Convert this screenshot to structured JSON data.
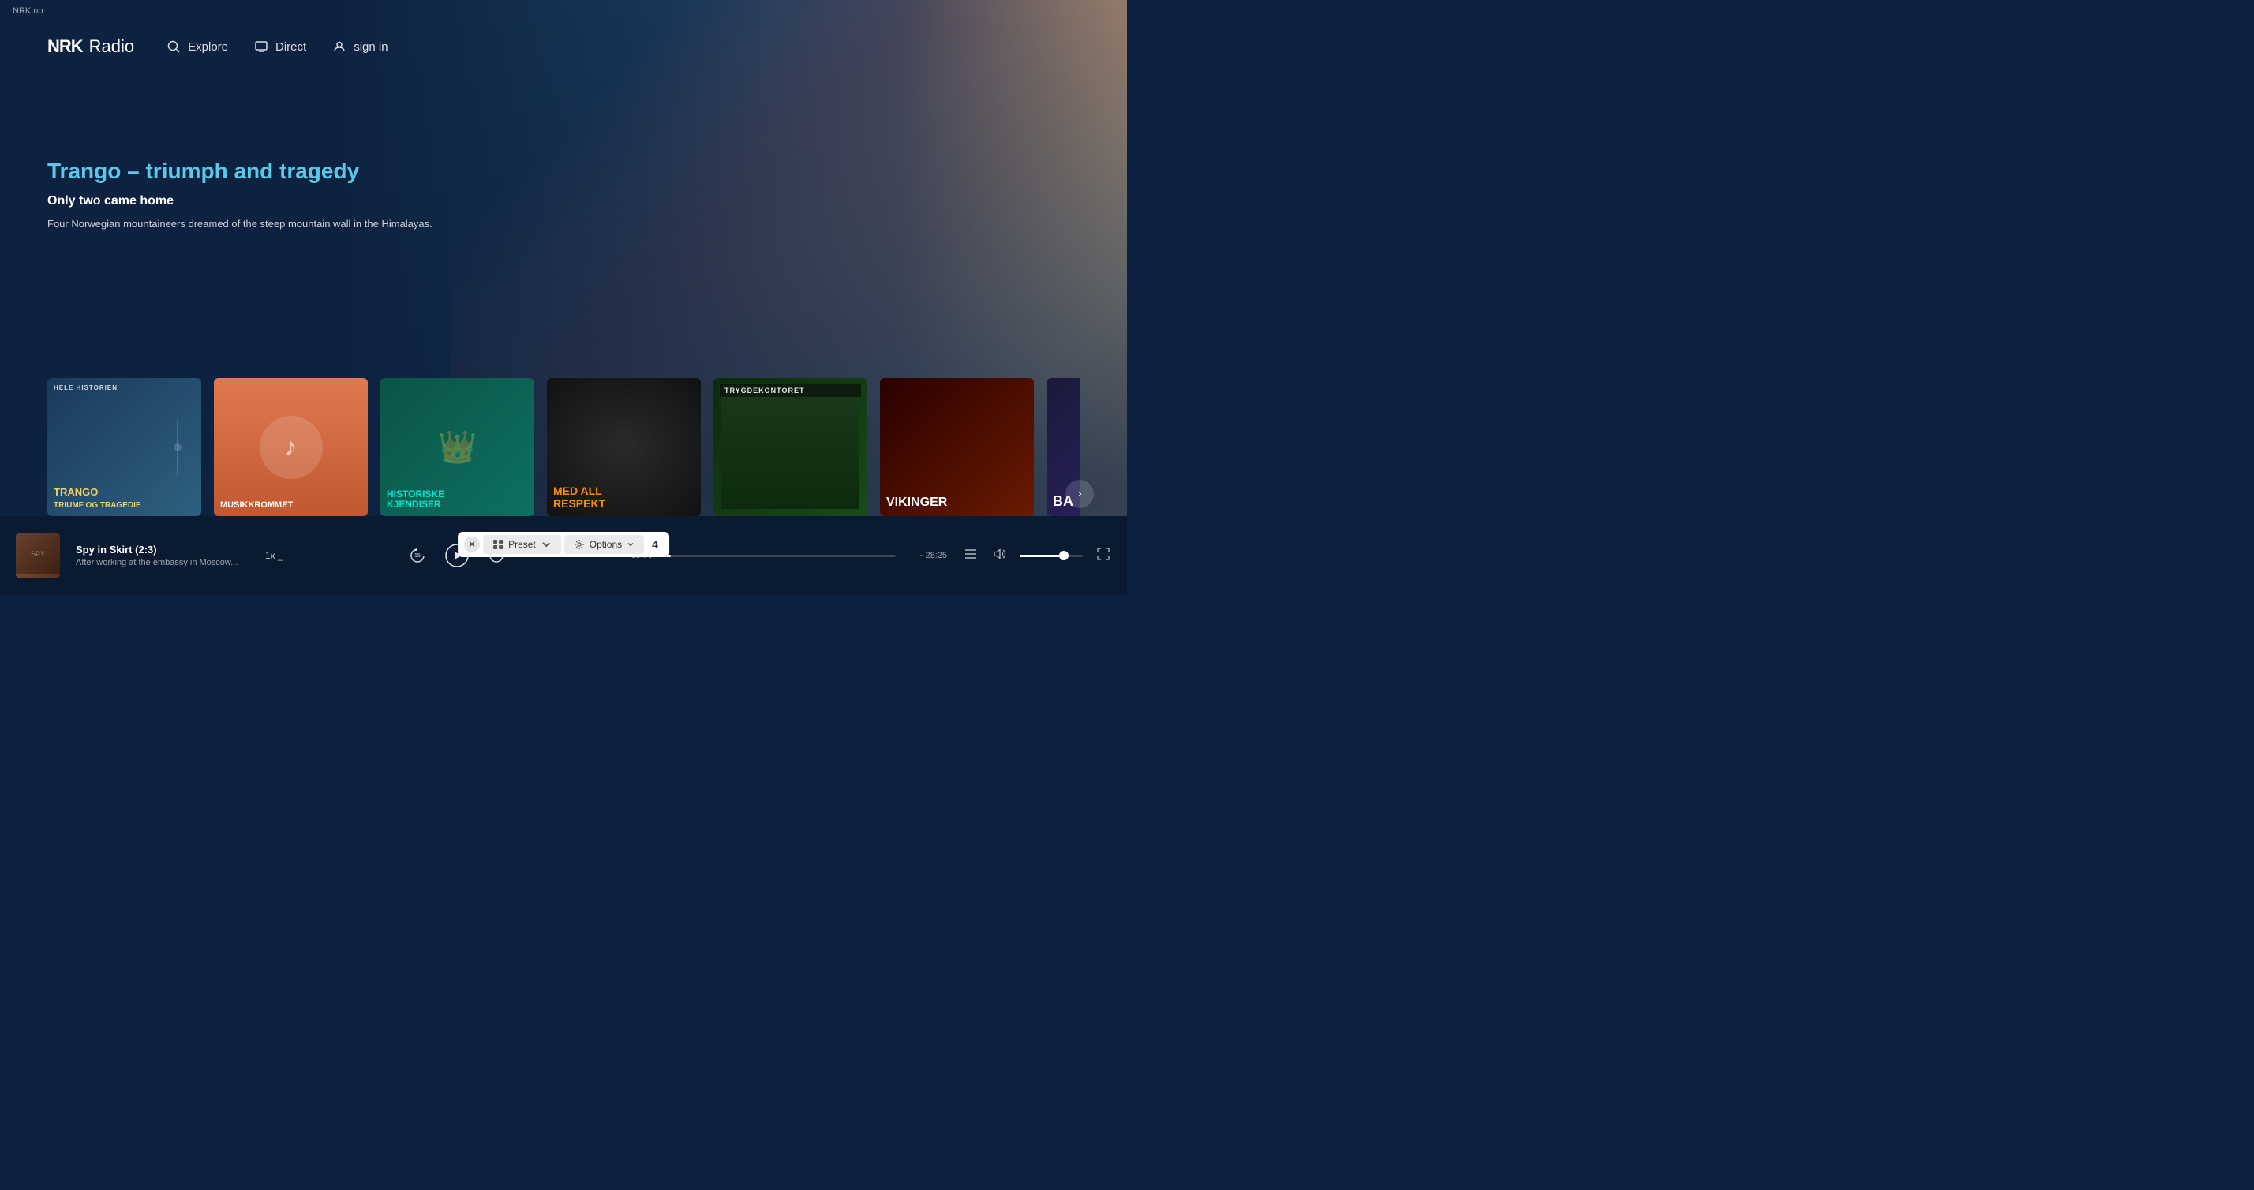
{
  "site": {
    "domain": "NRK.no"
  },
  "header": {
    "logo_nrk": "NRK",
    "logo_radio": "Radio",
    "nav": [
      {
        "id": "explore",
        "label": "Explore",
        "icon": "search-icon"
      },
      {
        "id": "direct",
        "label": "Direct",
        "icon": "tv-icon"
      },
      {
        "id": "signin",
        "label": "sign in",
        "icon": "user-icon"
      }
    ]
  },
  "hero": {
    "title": "Trango – triumph and tragedy",
    "subtitle": "Only two came home",
    "description": "Four Norwegian mountaineers dreamed of the steep mountain wall in the Himalayas."
  },
  "carousel": {
    "items": [
      {
        "id": "trango",
        "label": "HELE HISTORIEN",
        "title": "TRANGO\nTRIUMF OG TRAGEDIE",
        "title_color": "yellow",
        "card_class": "card-trango"
      },
      {
        "id": "musikkrommet",
        "label": "",
        "title": "MUSIKKROMMET",
        "title_color": "white",
        "card_class": "card-musikkrommet"
      },
      {
        "id": "historiske",
        "label": "",
        "title": "HISTORISKE KJENDISER",
        "title_color": "teal",
        "card_class": "card-historiske"
      },
      {
        "id": "med-all",
        "label": "",
        "title": "MED ALL RESPEKT",
        "title_color": "orange",
        "card_class": "card-med-all"
      },
      {
        "id": "trygde",
        "label": "",
        "title": "TRYGDEKONTORET",
        "title_color": "white",
        "card_class": "card-trygde"
      },
      {
        "id": "vikinger",
        "label": "",
        "title": "VIKINGER",
        "title_color": "white",
        "card_class": "card-vikinger"
      },
      {
        "id": "ba",
        "label": "",
        "title": "BA",
        "title_color": "white",
        "card_class": "card-ba"
      }
    ],
    "next_label": "→"
  },
  "player": {
    "thumbnail_alt": "Spy in Skirt",
    "title": "Spy in Skirt (2:3)",
    "subtitle": "After working at the embassy in Moscow...",
    "speed": "1x",
    "speed_suffix": "_",
    "time_current": "00:00",
    "time_total": "- 28:25",
    "progress_percent": 2,
    "controls": {
      "rewind_label": "⟲15",
      "play_label": "▶",
      "forward_label": "⟳15"
    },
    "volume_percent": 70,
    "buttons": {
      "queue": "☰",
      "volume": "🔊",
      "fullscreen": "⤢"
    }
  },
  "preset_bar": {
    "close_label": "✕",
    "preset_label": "Preset",
    "options_label": "Options",
    "count": "4"
  }
}
